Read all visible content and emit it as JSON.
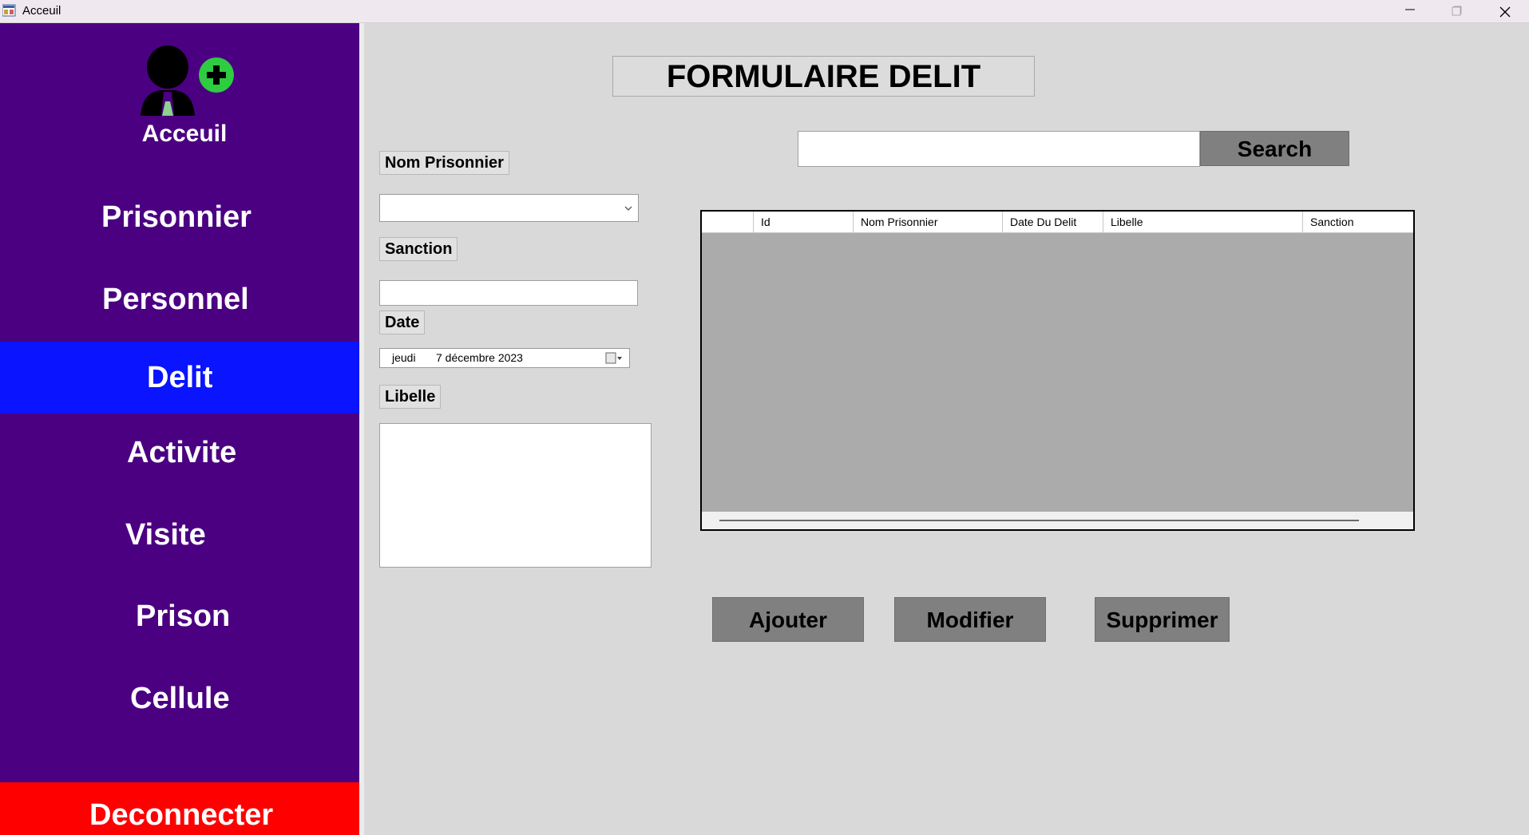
{
  "window": {
    "title": "Acceuil"
  },
  "sidebar": {
    "home_label": "Acceuil",
    "items": [
      {
        "label": "Prisonnier"
      },
      {
        "label": "Personnel"
      },
      {
        "label": "Delit",
        "active": true
      },
      {
        "label": "Activite"
      },
      {
        "label": "Visite"
      },
      {
        "label": "Prison"
      },
      {
        "label": "Cellule"
      }
    ],
    "logout_label": "Deconnecter",
    "colors": {
      "background": "#4b0082",
      "active": "#0a14ff",
      "logout": "#ff0000"
    }
  },
  "form": {
    "title": "FORMULAIRE DELIT",
    "nom_prisonnier_label": "Nom Prisonnier",
    "nom_prisonnier_value": "",
    "sanction_label": "Sanction",
    "sanction_value": "",
    "date_label": "Date",
    "date_day": "jeudi",
    "date_value": "7 décembre 2023",
    "libelle_label": "Libelle",
    "libelle_value": ""
  },
  "search": {
    "value": "",
    "button_label": "Search"
  },
  "grid": {
    "columns": [
      "Id",
      "Nom Prisonnier",
      "Date Du Delit",
      "Libelle",
      "Sanction"
    ],
    "rows": []
  },
  "actions": {
    "add_label": "Ajouter",
    "edit_label": "Modifier",
    "delete_label": "Supprimer"
  }
}
